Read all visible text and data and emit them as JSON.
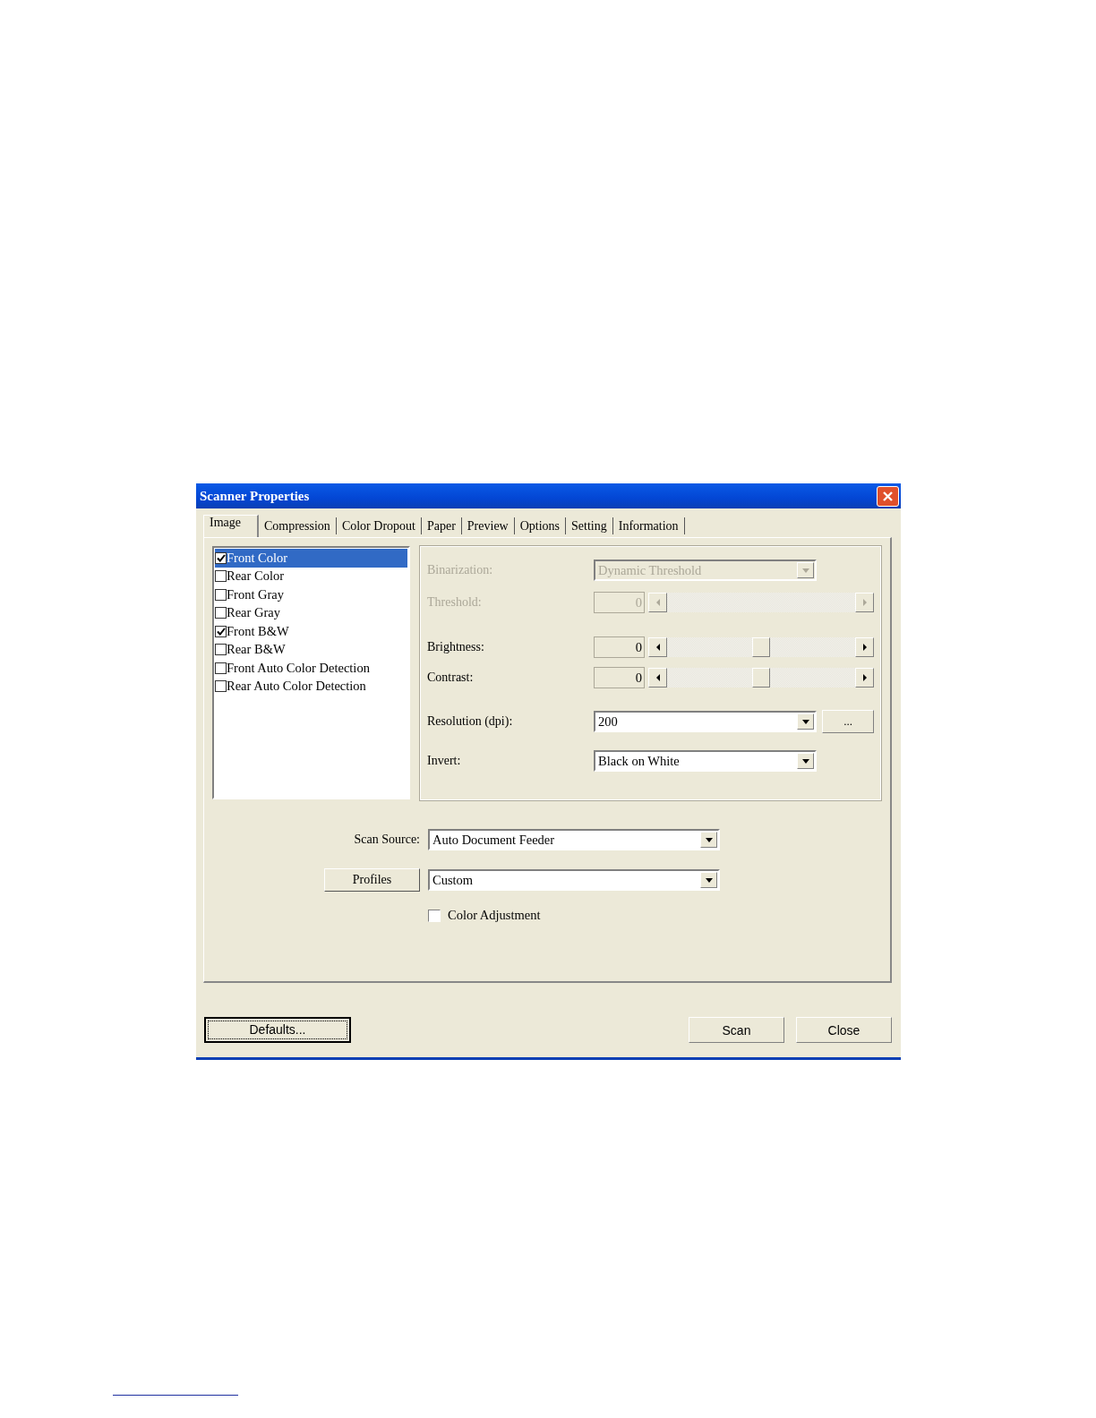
{
  "window": {
    "title": "Scanner Properties"
  },
  "tabs": [
    {
      "label": "Image",
      "selected": true
    },
    {
      "label": "Compression",
      "selected": false
    },
    {
      "label": "Color Dropout",
      "selected": false
    },
    {
      "label": "Paper",
      "selected": false
    },
    {
      "label": "Preview",
      "selected": false
    },
    {
      "label": "Options",
      "selected": false
    },
    {
      "label": "Setting",
      "selected": false
    },
    {
      "label": "Information",
      "selected": false
    }
  ],
  "image_types": [
    {
      "label": "Front Color",
      "checked": true,
      "selected": true
    },
    {
      "label": "Rear Color",
      "checked": false,
      "selected": false
    },
    {
      "label": "Front Gray",
      "checked": false,
      "selected": false
    },
    {
      "label": "Rear Gray",
      "checked": false,
      "selected": false
    },
    {
      "label": "Front B&W",
      "checked": true,
      "selected": false
    },
    {
      "label": "Rear B&W",
      "checked": false,
      "selected": false
    },
    {
      "label": "Front Auto Color Detection",
      "checked": false,
      "selected": false
    },
    {
      "label": "Rear Auto Color Detection",
      "checked": false,
      "selected": false
    }
  ],
  "settings": [
    {
      "kind": "dropdown",
      "label": "Binarization:",
      "value": "Dynamic Threshold",
      "disabled": true
    },
    {
      "kind": "slider",
      "label": "Threshold:",
      "value": "0",
      "disabled": true
    },
    {
      "kind": "slider",
      "label": "Brightness:",
      "value": "0",
      "level": 0.5,
      "disabled": false
    },
    {
      "kind": "slider",
      "label": "Contrast:",
      "value": "0",
      "level": 0.5,
      "disabled": false
    },
    {
      "kind": "dropdown",
      "label": "Resolution (dpi):",
      "value": "200",
      "disabled": false,
      "more_button": "..."
    },
    {
      "kind": "dropdown",
      "label": "Invert:",
      "value": "Black on White",
      "disabled": false
    }
  ],
  "scan_source": {
    "label": "Scan Source:",
    "value": "Auto Document Feeder"
  },
  "profiles": {
    "button": "Profiles",
    "value": "Custom"
  },
  "color_adjustment": {
    "label": "Color Adjustment",
    "checked": false
  },
  "buttons": [
    {
      "label": "Defaults...",
      "focused": true
    },
    {
      "label": "Scan",
      "focused": false
    },
    {
      "label": "Close",
      "focused": false
    }
  ]
}
